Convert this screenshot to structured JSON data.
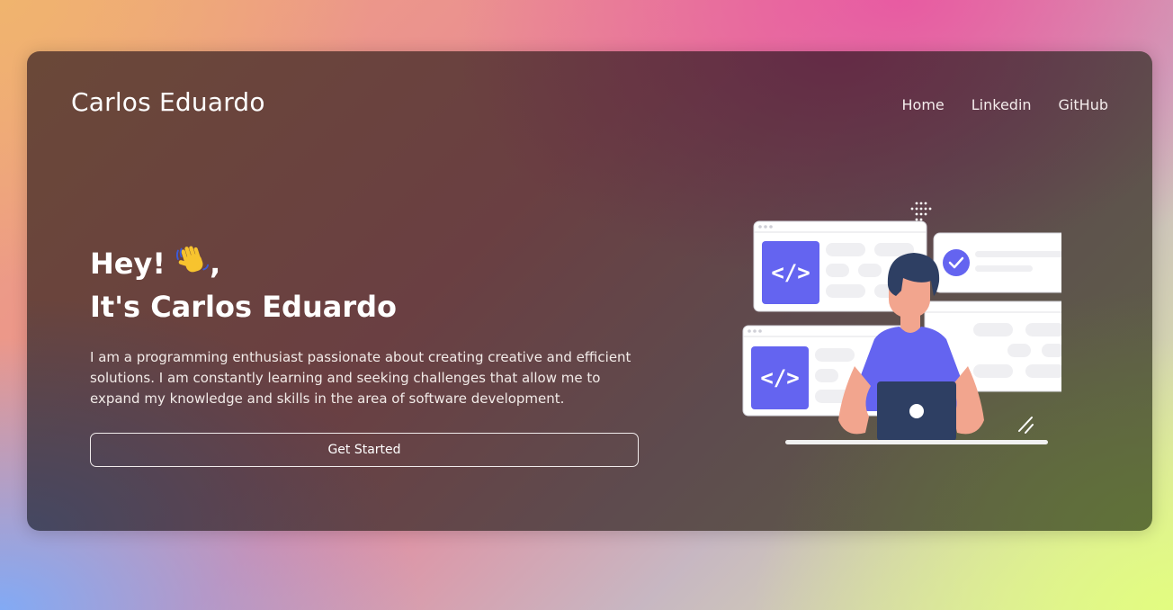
{
  "nav": {
    "brand": "Carlos Eduardo",
    "links": [
      {
        "label": "Home"
      },
      {
        "label": "Linkedin"
      },
      {
        "label": "GitHub"
      }
    ]
  },
  "hero": {
    "greeting": "Hey!",
    "greeting_suffix": ",",
    "greeting_emoji_icon": "waving-hand-icon",
    "name_line": "It's Carlos Eduardo",
    "description": "I am a programming enthusiast passionate about creating creative and efficient solutions. I am constantly learning and seeking challenges that allow me to expand my knowledge and skills in the area of software development.",
    "cta_label": "Get Started"
  },
  "illustration": {
    "code_glyph": "</>",
    "icons": [
      "code-icon",
      "check-circle-icon",
      "laptop-icon"
    ]
  },
  "colors": {
    "accent": "#6464f0",
    "skin": "#f2a58e",
    "hair": "#2e3f63",
    "laptop": "#2e3f63"
  }
}
